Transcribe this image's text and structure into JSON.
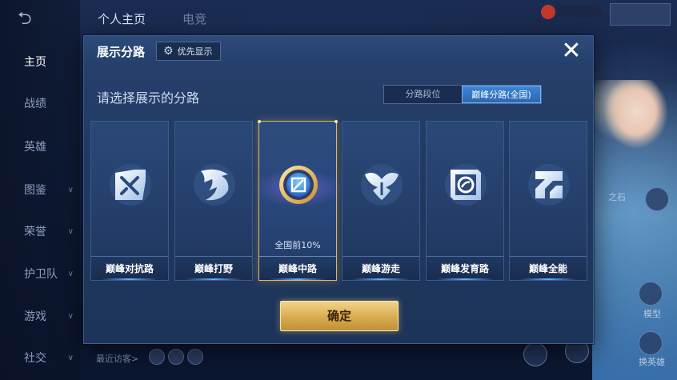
{
  "nav": {
    "back_icon": "back-arrow-icon",
    "items": [
      {
        "label": "主页",
        "active": true,
        "chevron": false
      },
      {
        "label": "战绩",
        "active": false,
        "chevron": false
      },
      {
        "label": "英雄",
        "active": false,
        "chevron": false
      },
      {
        "label": "图鉴",
        "active": false,
        "chevron": true
      },
      {
        "label": "荣誉",
        "active": false,
        "chevron": true
      },
      {
        "label": "护卫队",
        "active": false,
        "chevron": true
      },
      {
        "label": "游戏",
        "active": false,
        "chevron": true
      },
      {
        "label": "社交",
        "active": false,
        "chevron": true
      }
    ]
  },
  "top_tabs": [
    "个人主页",
    "电竞"
  ],
  "visitors_label": "最近访客>",
  "right_panel": {
    "model_label": "模型",
    "change_hero_label": "换英雄",
    "item_label": "之石"
  },
  "modal": {
    "title": "展示分路",
    "priority_button": "优先显示",
    "priority_icon": "gear-icon",
    "close_icon": "close-icon",
    "subtitle": "请选择展示的分路",
    "segment": {
      "options": [
        "分路段位",
        "巅峰分路(全国)"
      ],
      "selected_index": 1
    },
    "cards": [
      {
        "label": "巅峰对抗路",
        "icon": "crossed-swords-icon",
        "selected": false
      },
      {
        "label": "巅峰打野",
        "icon": "dragon-claw-icon",
        "selected": false
      },
      {
        "label": "巅峰中路",
        "icon": "mid-lane-emblem-icon",
        "selected": true,
        "rank": "全国前10%"
      },
      {
        "label": "巅峰游走",
        "icon": "wings-icon",
        "selected": false
      },
      {
        "label": "巅峰发育路",
        "icon": "marksman-icon",
        "selected": false
      },
      {
        "label": "巅峰全能",
        "icon": "all-round-icon",
        "selected": false
      }
    ],
    "confirm_button": "确定"
  },
  "colors": {
    "accent_gold": "#e3b65a",
    "accent_blue": "#3d85d6",
    "panel": "#213a63"
  }
}
